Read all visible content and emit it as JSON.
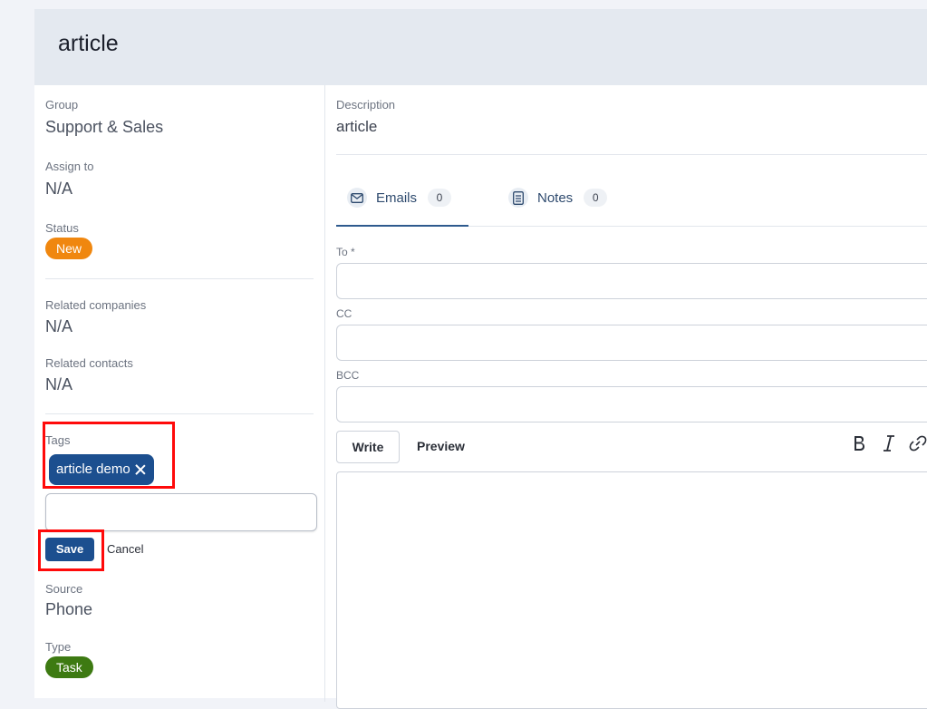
{
  "header": {
    "title": "article"
  },
  "left": {
    "group": {
      "label": "Group",
      "value": "Support & Sales"
    },
    "assign": {
      "label": "Assign to",
      "value": "N/A"
    },
    "status": {
      "label": "Status",
      "value": "New",
      "color": "#f0870f"
    },
    "related_companies": {
      "label": "Related companies",
      "value": "N/A"
    },
    "related_contacts": {
      "label": "Related contacts",
      "value": "N/A"
    },
    "tags": {
      "label": "Tags",
      "items": [
        "article demo"
      ],
      "input_value": ""
    },
    "save_label": "Save",
    "cancel_label": "Cancel",
    "source": {
      "label": "Source",
      "value": "Phone"
    },
    "type": {
      "label": "Type",
      "value": "Task",
      "color": "#3d7a12"
    }
  },
  "right": {
    "description": {
      "label": "Description",
      "value": "article"
    },
    "tabs": [
      {
        "label": "Emails",
        "count": "0",
        "icon": "envelope-icon"
      },
      {
        "label": "Notes",
        "count": "0",
        "icon": "notes-icon"
      }
    ],
    "fields": {
      "to": "To *",
      "cc": "CC",
      "bcc": "BCC"
    },
    "editor": {
      "write": "Write",
      "preview": "Preview",
      "tools": [
        "bold-icon",
        "italic-icon",
        "link-icon"
      ]
    }
  },
  "colors": {
    "accent": "#1c4f8f",
    "highlight": "#ff0a0a"
  }
}
